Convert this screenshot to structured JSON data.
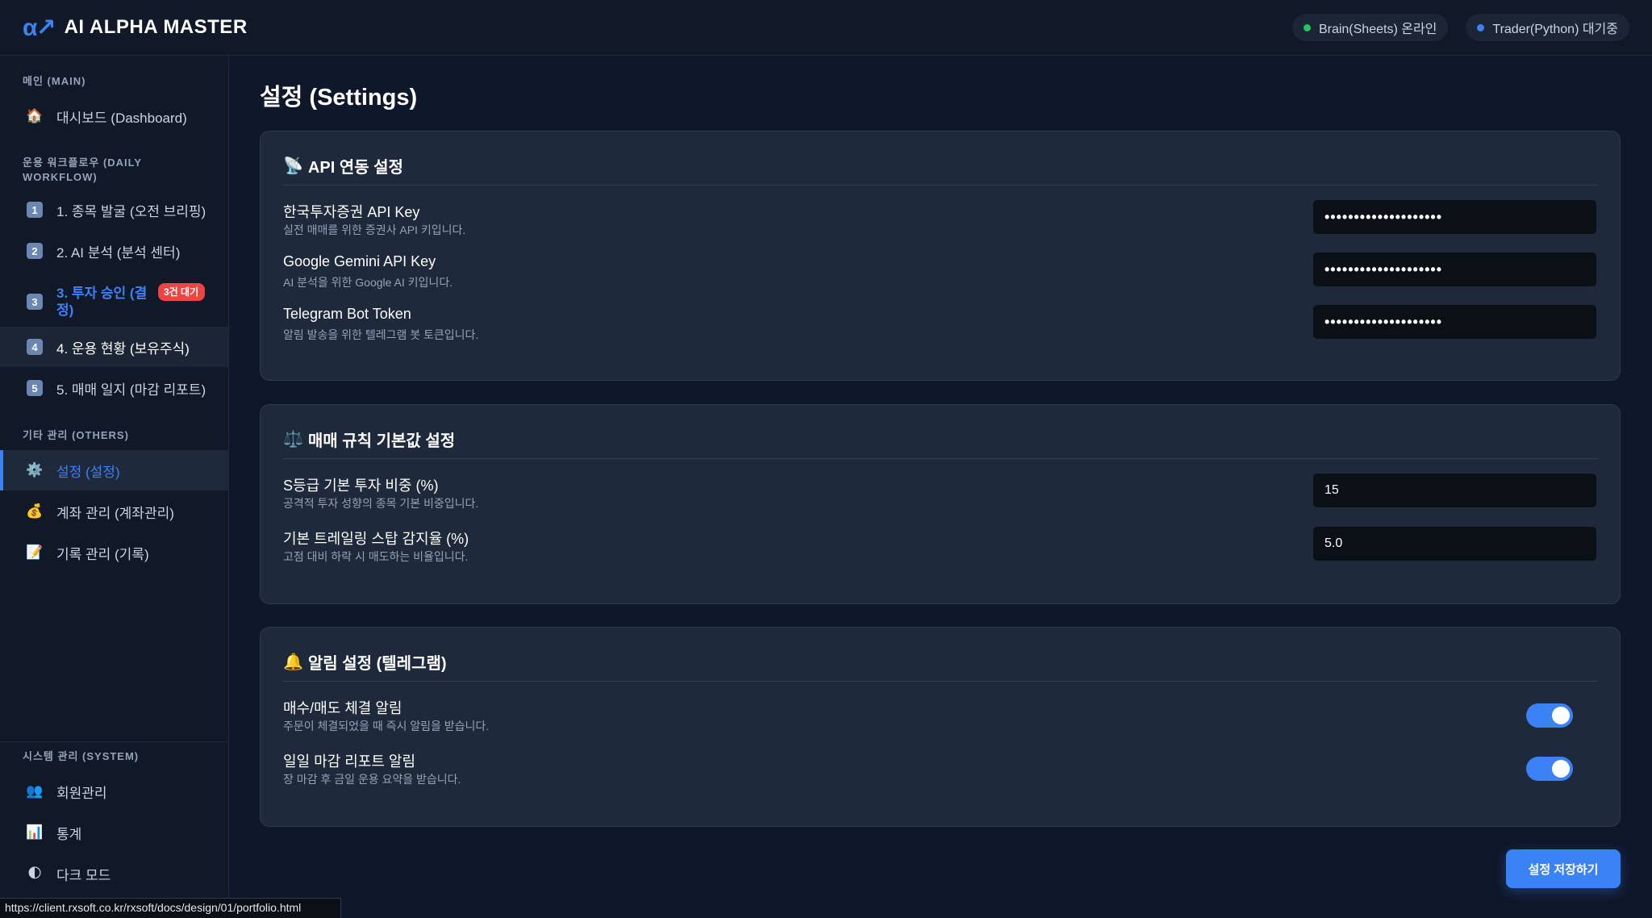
{
  "header": {
    "logo_icon": "α↗",
    "app_title": "AI ALPHA MASTER",
    "status": [
      {
        "label": "Brain(Sheets) 온라인",
        "color": "#22c55e"
      },
      {
        "label": "Trader(Python) 대기중",
        "color": "#3b82f6"
      }
    ]
  },
  "sidebar": {
    "main_label": "메인 (MAIN)",
    "dashboard": {
      "icon": "🏠",
      "label": "대시보드 (Dashboard)"
    },
    "workflow_label": "운용 워크플로우 (DAILY WORKFLOW)",
    "workflow": [
      {
        "num": "1",
        "label": "1. 종목 발굴 (오전 브리핑)"
      },
      {
        "num": "2",
        "label": "2. AI 분석 (분석 센터)"
      },
      {
        "num": "3",
        "label": "3. 투자 승인 (결정)",
        "badge": "3건 대기"
      },
      {
        "num": "4",
        "label": "4. 운용 현황 (보유주식)"
      },
      {
        "num": "5",
        "label": "5. 매매 일지 (마감 리포트)"
      }
    ],
    "others_label": "기타 관리 (OTHERS)",
    "others": [
      {
        "icon": "⚙️",
        "label": "설정 (설정)"
      },
      {
        "icon": "💰",
        "label": "계좌 관리 (계좌관리)"
      },
      {
        "icon": "📝",
        "label": "기록 관리 (기록)"
      }
    ],
    "system_label": "시스템 관리 (SYSTEM)",
    "system": [
      {
        "icon": "👥",
        "label": "회원관리"
      },
      {
        "icon": "📊",
        "label": "통계"
      },
      {
        "icon": "🌓",
        "label": "다크 모드"
      }
    ]
  },
  "main": {
    "page_title": "설정 (Settings)",
    "api_card": {
      "icon": "📡",
      "title": "API 연동 설정",
      "rows": [
        {
          "label": "한국투자증권 API Key",
          "desc": "실전 매매를 위한 증권사 API 키입니다.",
          "value": "••••••••••••••••••••"
        },
        {
          "label": "Google Gemini API Key",
          "desc": "AI 분석을 위한 Google AI 키입니다.",
          "value": "••••••••••••••••••••"
        },
        {
          "label": "Telegram Bot Token",
          "desc": "알림 발송을 위한 텔레그램 봇 토큰입니다.",
          "value": "••••••••••••••••••••"
        }
      ]
    },
    "rules_card": {
      "icon": "⚖️",
      "title": "매매 규칙 기본값 설정",
      "rows": [
        {
          "label": "S등급 기본 투자 비중 (%)",
          "desc": "공격적 투자 성향의 종목 기본 비중입니다.",
          "value": "15"
        },
        {
          "label": "기본 트레일링 스탑 감지율 (%)",
          "desc": "고점 대비 하락 시 매도하는 비율입니다.",
          "value": "5.0"
        }
      ]
    },
    "alert_card": {
      "icon": "🔔",
      "title": "알림 설정 (텔레그램)",
      "rows": [
        {
          "label": "매수/매도 체결 알림",
          "desc": "주문이 체결되었을 때 즉시 알림을 받습니다.",
          "enabled": true
        },
        {
          "label": "일일 마감 리포트 알림",
          "desc": "장 마감 후 금일 운용 요약을 받습니다.",
          "enabled": true
        }
      ]
    },
    "save_label": "설정 저장하기"
  },
  "status_bar_url": "https://client.rxsoft.co.kr/rxsoft/docs/design/01/portfolio.html"
}
